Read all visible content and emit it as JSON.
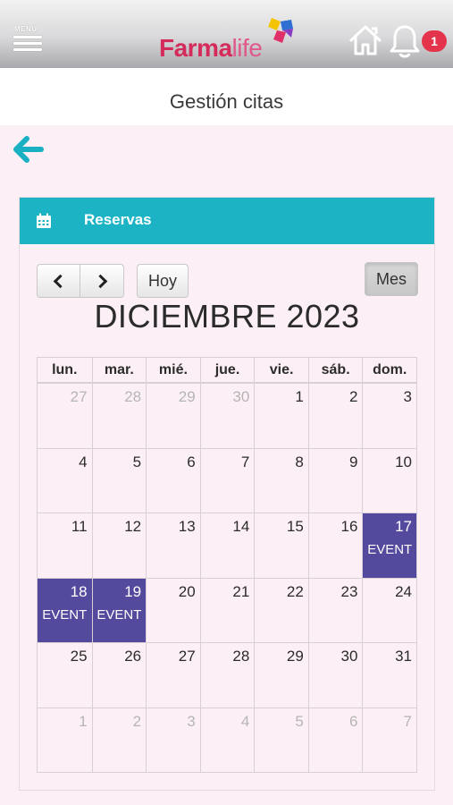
{
  "header": {
    "menu_label": "MENÚ",
    "logo_part1": "Farma",
    "logo_part2": "life",
    "notification_count": "1",
    "colors": {
      "brand": "#d52b5b",
      "badge": "#e3344c"
    }
  },
  "page": {
    "title": "Gestión citas"
  },
  "panel": {
    "title": "Reservas",
    "header_color": "#1cb3c5"
  },
  "toolbar": {
    "today_label": "Hoy",
    "month_label": "Mes"
  },
  "calendar": {
    "month_title": "DICIEMBRE 2023",
    "event_color": "#534a9e",
    "weekdays": [
      "lun.",
      "mar.",
      "mié.",
      "jue.",
      "vie.",
      "sáb.",
      "dom."
    ],
    "weeks": [
      [
        {
          "d": "27",
          "other": true
        },
        {
          "d": "28",
          "other": true
        },
        {
          "d": "29",
          "other": true
        },
        {
          "d": "30",
          "other": true
        },
        {
          "d": "1"
        },
        {
          "d": "2"
        },
        {
          "d": "3"
        }
      ],
      [
        {
          "d": "4"
        },
        {
          "d": "5"
        },
        {
          "d": "6"
        },
        {
          "d": "7"
        },
        {
          "d": "8"
        },
        {
          "d": "9"
        },
        {
          "d": "10"
        }
      ],
      [
        {
          "d": "11"
        },
        {
          "d": "12"
        },
        {
          "d": "13"
        },
        {
          "d": "14"
        },
        {
          "d": "15"
        },
        {
          "d": "16"
        },
        {
          "d": "17",
          "event": "EVENT"
        }
      ],
      [
        {
          "d": "18",
          "event": "EVENT"
        },
        {
          "d": "19",
          "event": "EVENT"
        },
        {
          "d": "20"
        },
        {
          "d": "21"
        },
        {
          "d": "22"
        },
        {
          "d": "23"
        },
        {
          "d": "24"
        }
      ],
      [
        {
          "d": "25"
        },
        {
          "d": "26"
        },
        {
          "d": "27"
        },
        {
          "d": "28"
        },
        {
          "d": "29"
        },
        {
          "d": "30"
        },
        {
          "d": "31"
        }
      ],
      [
        {
          "d": "1",
          "other": true
        },
        {
          "d": "2",
          "other": true
        },
        {
          "d": "3",
          "other": true
        },
        {
          "d": "4",
          "other": true
        },
        {
          "d": "5",
          "other": true
        },
        {
          "d": "6",
          "other": true
        },
        {
          "d": "7",
          "other": true
        }
      ]
    ]
  }
}
